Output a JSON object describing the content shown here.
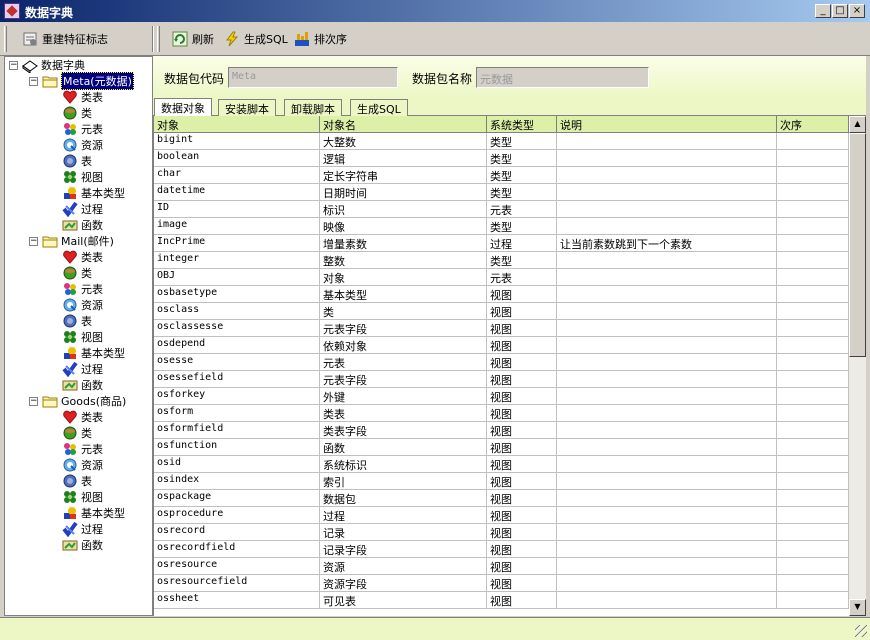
{
  "window": {
    "title": "数据字典"
  },
  "toolbar": {
    "rebuild_label": "重建特征标志",
    "refresh_label": "刷新",
    "gensql_label": "生成SQL",
    "order_label": "排次序"
  },
  "tree": {
    "root": "数据字典",
    "packages": [
      {
        "label": "Meta(元数据)"
      },
      {
        "label": "Mail(邮件)"
      },
      {
        "label": "Goods(商品)"
      }
    ],
    "children": [
      "类表",
      "类",
      "元表",
      "资源",
      "表",
      "视图",
      "基本类型",
      "过程",
      "函数"
    ]
  },
  "info": {
    "code_label": "数据包代码",
    "code_value": "Meta",
    "name_label": "数据包名称",
    "name_value": "元数据"
  },
  "tabs": [
    "数据对象",
    "安装脚本",
    "卸载脚本",
    "生成SQL"
  ],
  "grid": {
    "columns": [
      "对象",
      "对象名",
      "系统类型",
      "说明",
      "次序"
    ],
    "rows": [
      [
        "bigint",
        "大整数",
        "类型",
        "",
        ""
      ],
      [
        "boolean",
        "逻辑",
        "类型",
        "",
        ""
      ],
      [
        "char",
        "定长字符串",
        "类型",
        "",
        ""
      ],
      [
        "datetime",
        "日期时间",
        "类型",
        "",
        ""
      ],
      [
        "ID",
        "标识",
        "元表",
        "",
        ""
      ],
      [
        "image",
        "映像",
        "类型",
        "",
        ""
      ],
      [
        "IncPrime",
        "增量素数",
        "过程",
        "让当前素数跳到下一个素数",
        ""
      ],
      [
        "integer",
        "整数",
        "类型",
        "",
        ""
      ],
      [
        "OBJ",
        "对象",
        "元表",
        "",
        ""
      ],
      [
        "osbasetype",
        "基本类型",
        "视图",
        "",
        ""
      ],
      [
        "osclass",
        "类",
        "视图",
        "",
        ""
      ],
      [
        "osclassesse",
        "元表字段",
        "视图",
        "",
        ""
      ],
      [
        "osdepend",
        "依赖对象",
        "视图",
        "",
        ""
      ],
      [
        "osesse",
        "元表",
        "视图",
        "",
        ""
      ],
      [
        "osessefield",
        "元表字段",
        "视图",
        "",
        ""
      ],
      [
        "osforkey",
        "外键",
        "视图",
        "",
        ""
      ],
      [
        "osform",
        "类表",
        "视图",
        "",
        ""
      ],
      [
        "osformfield",
        "类表字段",
        "视图",
        "",
        ""
      ],
      [
        "osfunction",
        "函数",
        "视图",
        "",
        ""
      ],
      [
        "osid",
        "系统标识",
        "视图",
        "",
        ""
      ],
      [
        "osindex",
        "索引",
        "视图",
        "",
        ""
      ],
      [
        "ospackage",
        "数据包",
        "视图",
        "",
        ""
      ],
      [
        "osprocedure",
        "过程",
        "视图",
        "",
        ""
      ],
      [
        "osrecord",
        "记录",
        "视图",
        "",
        ""
      ],
      [
        "osrecordfield",
        "记录字段",
        "视图",
        "",
        ""
      ],
      [
        "osresource",
        "资源",
        "视图",
        "",
        ""
      ],
      [
        "osresourcefield",
        "资源字段",
        "视图",
        "",
        ""
      ],
      [
        "ossheet",
        "可见表",
        "视图",
        "",
        ""
      ]
    ]
  }
}
